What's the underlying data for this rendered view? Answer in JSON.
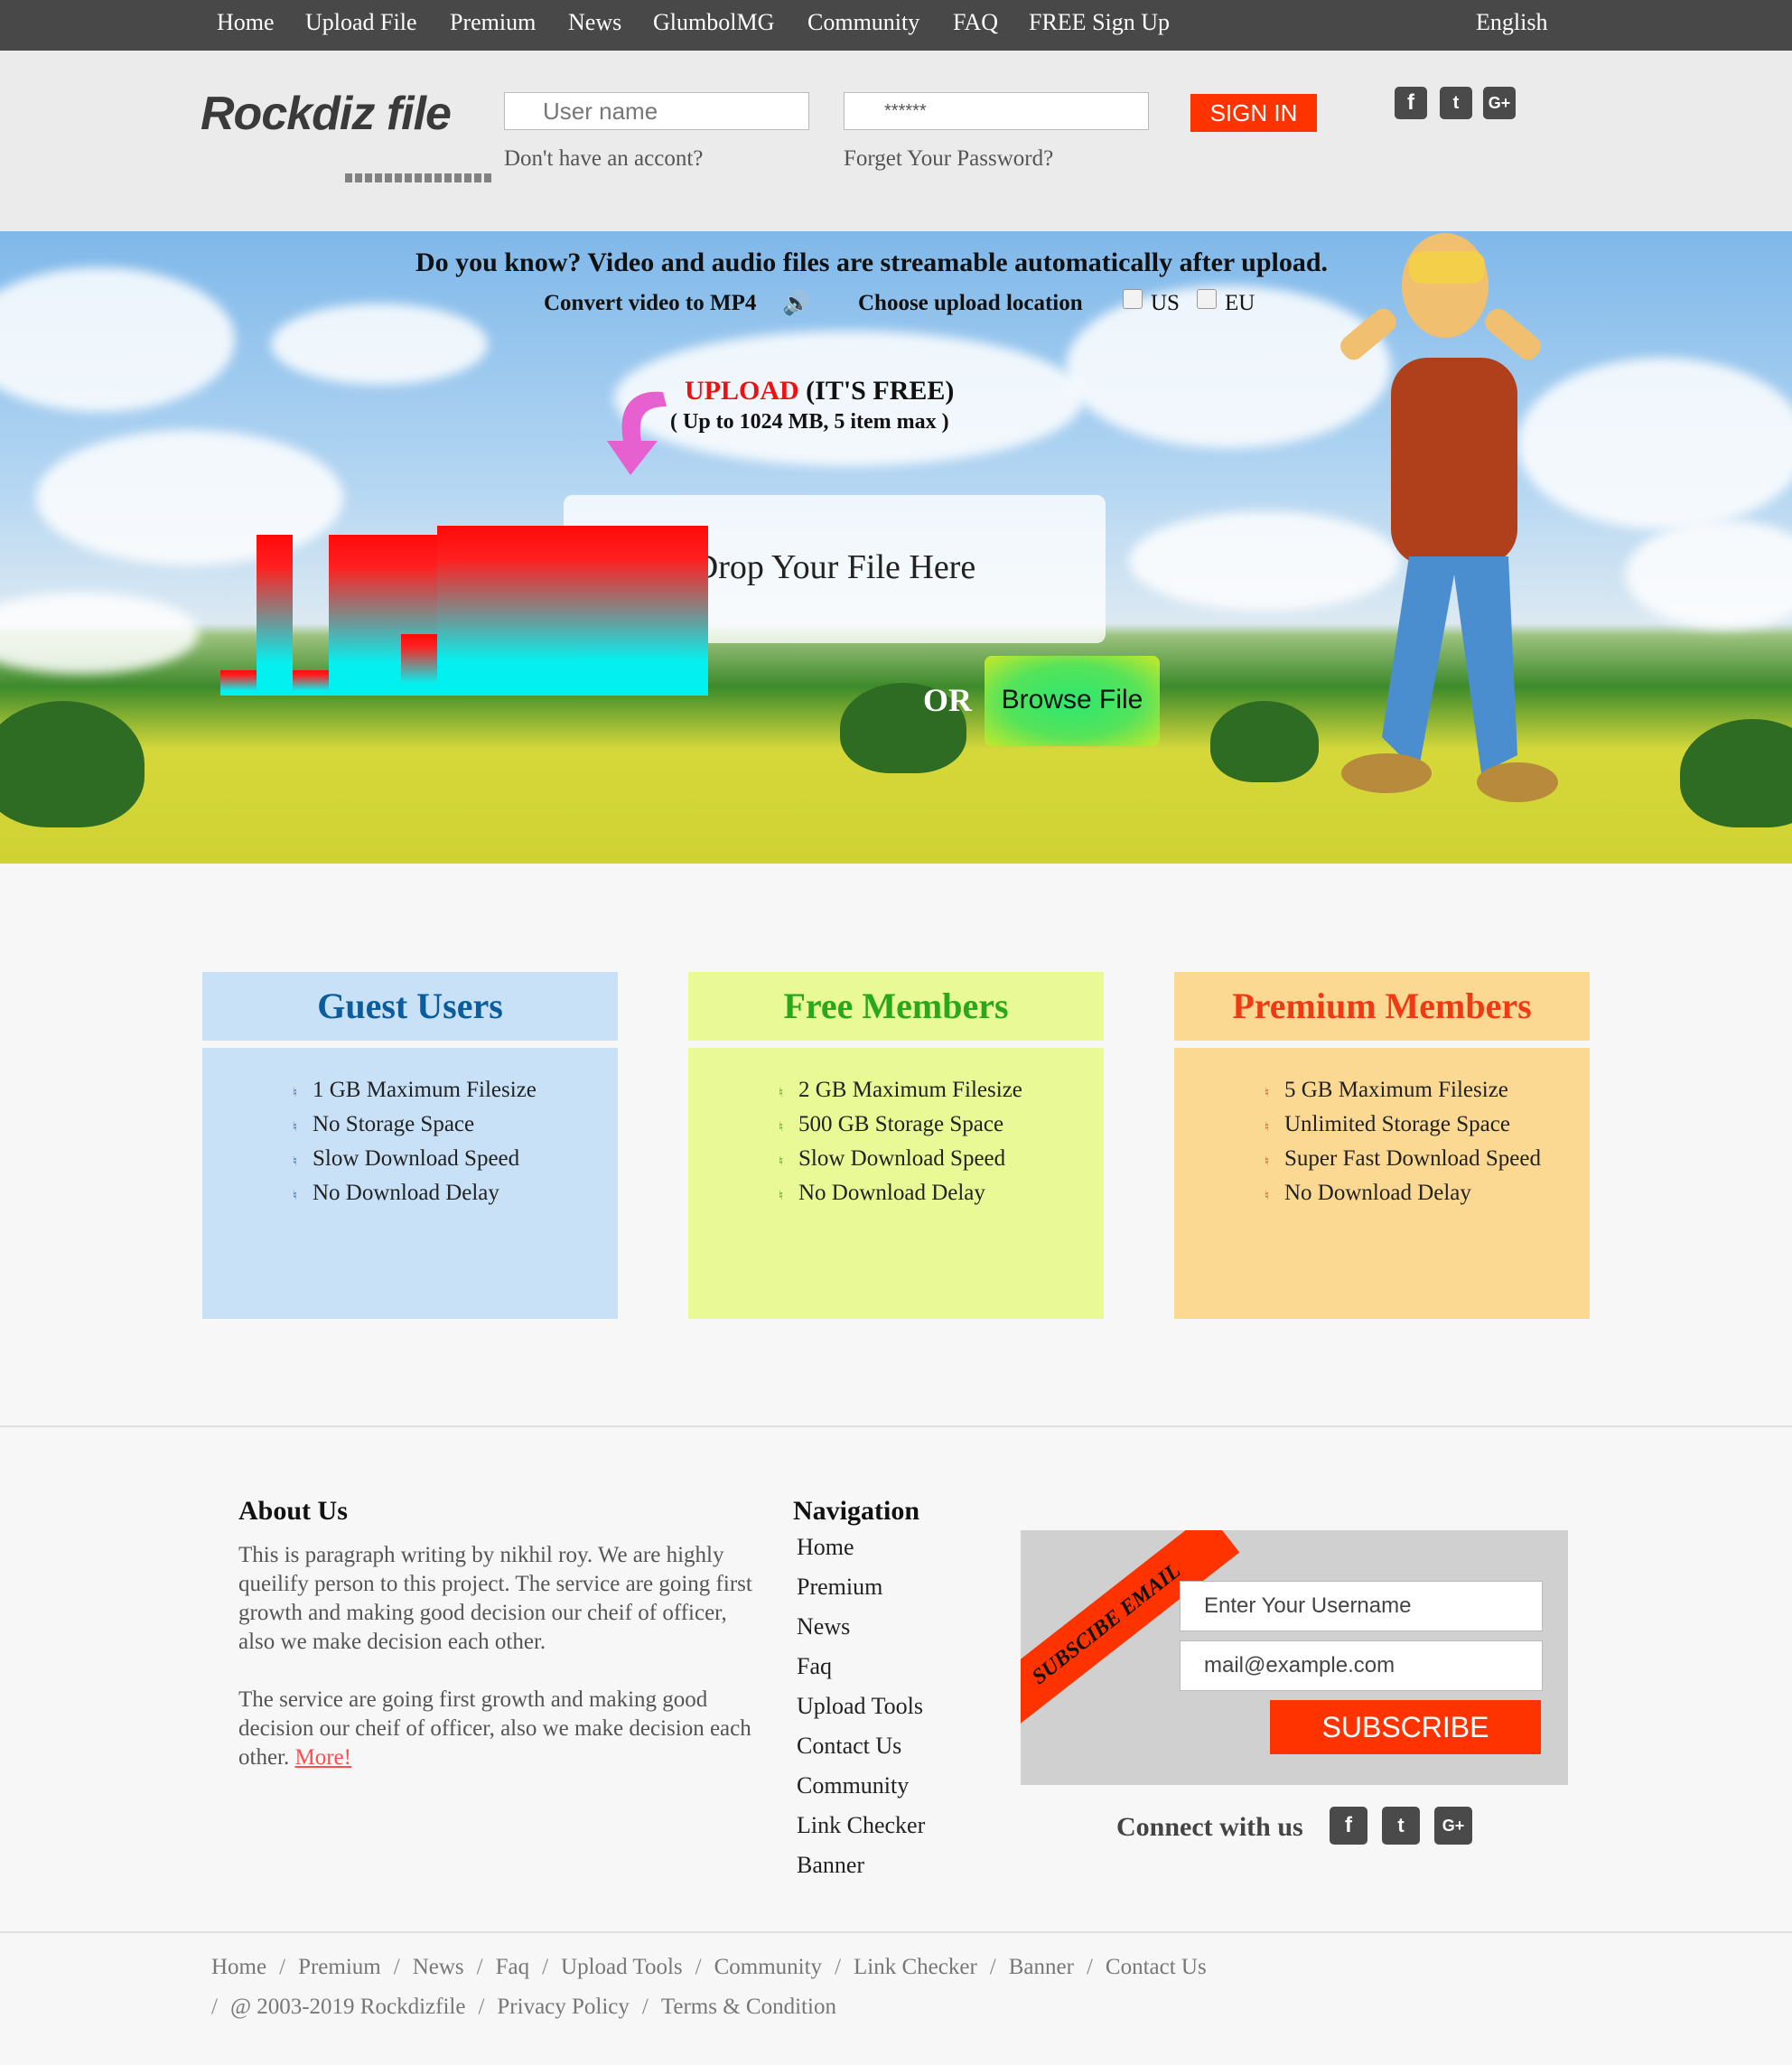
{
  "topnav": {
    "items": [
      "Home",
      "Upload File",
      "Premium",
      "News",
      "GlumbolMG",
      "Community",
      "FAQ",
      "FREE Sign Up"
    ],
    "language": "English"
  },
  "header": {
    "logo": "Rockdiz file",
    "username_placeholder": "User name",
    "password_value": "******",
    "signin_label": "SIGN IN",
    "no_account": "Don't have an accont?",
    "forgot": "Forget Your Password?",
    "social": [
      "facebook-icon",
      "twitter-icon",
      "google-plus-icon"
    ]
  },
  "hero": {
    "title": "Do you know? Video and audio files are streamable automatically after upload.",
    "convert": "Convert video to MP4",
    "speaker_glyph": "🔊",
    "choose_location": "Choose upload location",
    "loc_us": "US",
    "loc_eu": "EU",
    "upload_word": "UPLOAD",
    "upload_free": "(IT'S FREE)",
    "upload_limit": "( Up to 1024 MB, 5 item max )",
    "dropzone_text": "Drop Your File Here",
    "or": "OR",
    "browse": "Browse File"
  },
  "cards": [
    {
      "title": "Guest Users",
      "title_color": "#0a5d9c",
      "head_bg": "#c8e1f7",
      "body_bg": "#c8e1f7",
      "bullet_color": "#1f6ab0",
      "items": [
        "1 GB Maximum Filesize",
        "No Storage Space",
        "Slow Download Speed",
        "No Download Delay"
      ]
    },
    {
      "title": "Free Members",
      "title_color": "#2aa81a",
      "head_bg": "#e8f995",
      "body_bg": "#e8f995",
      "bullet_color": "#2aa81a",
      "items": [
        "2 GB Maximum Filesize",
        "500 GB Storage Space",
        "Slow Download Speed",
        "No Download Delay"
      ]
    },
    {
      "title": "Premium Members",
      "title_color": "#f03a14",
      "head_bg": "#fbd993",
      "body_bg": "#fbd993",
      "bullet_color": "#f03a14",
      "items": [
        "5 GB Maximum Filesize",
        "Unlimited Storage Space",
        "Super Fast Download Speed",
        "No Download Delay"
      ]
    }
  ],
  "about": {
    "title": "About Us",
    "p1": "This is paragraph writing by nikhil roy. We are highly queilify person to this project. The service are going first growth and making good decision our cheif of officer, also we make decision each other.",
    "p2": "The service are going first growth and making good decision our cheif of officer, also we make decision each other.",
    "more": "More!"
  },
  "navigation": {
    "title": "Navigation",
    "links": [
      "Home",
      "Premium",
      "News",
      "Faq",
      "Upload Tools",
      "Contact Us",
      "Community",
      "Link Checker",
      "Banner"
    ]
  },
  "subscribe": {
    "ribbon": "SUBSCIBE EMAIL",
    "username_placeholder": "Enter Your Username",
    "email_placeholder": "mail@example.com",
    "button": "SUBSCRIBE",
    "connect": "Connect with us"
  },
  "footer": {
    "links": [
      "Home",
      "Premium",
      "News",
      "Faq",
      "Upload Tools",
      "Community",
      "Link Checker",
      "Banner",
      "Contact Us"
    ],
    "copyright": "@ 2003-2019 Rockdizfile",
    "privacy": "Privacy Policy",
    "terms": "Terms & Condition"
  },
  "colors": {
    "accent": "#ff3300",
    "nav_bg": "#484848"
  }
}
